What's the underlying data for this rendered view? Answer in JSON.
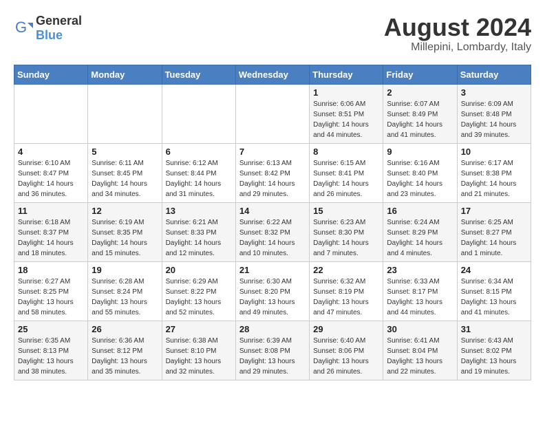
{
  "header": {
    "logo_general": "General",
    "logo_blue": "Blue",
    "title": "August 2024",
    "location": "Millepini, Lombardy, Italy"
  },
  "weekdays": [
    "Sunday",
    "Monday",
    "Tuesday",
    "Wednesday",
    "Thursday",
    "Friday",
    "Saturday"
  ],
  "weeks": [
    [
      {
        "day": "",
        "info": ""
      },
      {
        "day": "",
        "info": ""
      },
      {
        "day": "",
        "info": ""
      },
      {
        "day": "",
        "info": ""
      },
      {
        "day": "1",
        "info": "Sunrise: 6:06 AM\nSunset: 8:51 PM\nDaylight: 14 hours\nand 44 minutes."
      },
      {
        "day": "2",
        "info": "Sunrise: 6:07 AM\nSunset: 8:49 PM\nDaylight: 14 hours\nand 41 minutes."
      },
      {
        "day": "3",
        "info": "Sunrise: 6:09 AM\nSunset: 8:48 PM\nDaylight: 14 hours\nand 39 minutes."
      }
    ],
    [
      {
        "day": "4",
        "info": "Sunrise: 6:10 AM\nSunset: 8:47 PM\nDaylight: 14 hours\nand 36 minutes."
      },
      {
        "day": "5",
        "info": "Sunrise: 6:11 AM\nSunset: 8:45 PM\nDaylight: 14 hours\nand 34 minutes."
      },
      {
        "day": "6",
        "info": "Sunrise: 6:12 AM\nSunset: 8:44 PM\nDaylight: 14 hours\nand 31 minutes."
      },
      {
        "day": "7",
        "info": "Sunrise: 6:13 AM\nSunset: 8:42 PM\nDaylight: 14 hours\nand 29 minutes."
      },
      {
        "day": "8",
        "info": "Sunrise: 6:15 AM\nSunset: 8:41 PM\nDaylight: 14 hours\nand 26 minutes."
      },
      {
        "day": "9",
        "info": "Sunrise: 6:16 AM\nSunset: 8:40 PM\nDaylight: 14 hours\nand 23 minutes."
      },
      {
        "day": "10",
        "info": "Sunrise: 6:17 AM\nSunset: 8:38 PM\nDaylight: 14 hours\nand 21 minutes."
      }
    ],
    [
      {
        "day": "11",
        "info": "Sunrise: 6:18 AM\nSunset: 8:37 PM\nDaylight: 14 hours\nand 18 minutes."
      },
      {
        "day": "12",
        "info": "Sunrise: 6:19 AM\nSunset: 8:35 PM\nDaylight: 14 hours\nand 15 minutes."
      },
      {
        "day": "13",
        "info": "Sunrise: 6:21 AM\nSunset: 8:33 PM\nDaylight: 14 hours\nand 12 minutes."
      },
      {
        "day": "14",
        "info": "Sunrise: 6:22 AM\nSunset: 8:32 PM\nDaylight: 14 hours\nand 10 minutes."
      },
      {
        "day": "15",
        "info": "Sunrise: 6:23 AM\nSunset: 8:30 PM\nDaylight: 14 hours\nand 7 minutes."
      },
      {
        "day": "16",
        "info": "Sunrise: 6:24 AM\nSunset: 8:29 PM\nDaylight: 14 hours\nand 4 minutes."
      },
      {
        "day": "17",
        "info": "Sunrise: 6:25 AM\nSunset: 8:27 PM\nDaylight: 14 hours\nand 1 minute."
      }
    ],
    [
      {
        "day": "18",
        "info": "Sunrise: 6:27 AM\nSunset: 8:25 PM\nDaylight: 13 hours\nand 58 minutes."
      },
      {
        "day": "19",
        "info": "Sunrise: 6:28 AM\nSunset: 8:24 PM\nDaylight: 13 hours\nand 55 minutes."
      },
      {
        "day": "20",
        "info": "Sunrise: 6:29 AM\nSunset: 8:22 PM\nDaylight: 13 hours\nand 52 minutes."
      },
      {
        "day": "21",
        "info": "Sunrise: 6:30 AM\nSunset: 8:20 PM\nDaylight: 13 hours\nand 49 minutes."
      },
      {
        "day": "22",
        "info": "Sunrise: 6:32 AM\nSunset: 8:19 PM\nDaylight: 13 hours\nand 47 minutes."
      },
      {
        "day": "23",
        "info": "Sunrise: 6:33 AM\nSunset: 8:17 PM\nDaylight: 13 hours\nand 44 minutes."
      },
      {
        "day": "24",
        "info": "Sunrise: 6:34 AM\nSunset: 8:15 PM\nDaylight: 13 hours\nand 41 minutes."
      }
    ],
    [
      {
        "day": "25",
        "info": "Sunrise: 6:35 AM\nSunset: 8:13 PM\nDaylight: 13 hours\nand 38 minutes."
      },
      {
        "day": "26",
        "info": "Sunrise: 6:36 AM\nSunset: 8:12 PM\nDaylight: 13 hours\nand 35 minutes."
      },
      {
        "day": "27",
        "info": "Sunrise: 6:38 AM\nSunset: 8:10 PM\nDaylight: 13 hours\nand 32 minutes."
      },
      {
        "day": "28",
        "info": "Sunrise: 6:39 AM\nSunset: 8:08 PM\nDaylight: 13 hours\nand 29 minutes."
      },
      {
        "day": "29",
        "info": "Sunrise: 6:40 AM\nSunset: 8:06 PM\nDaylight: 13 hours\nand 26 minutes."
      },
      {
        "day": "30",
        "info": "Sunrise: 6:41 AM\nSunset: 8:04 PM\nDaylight: 13 hours\nand 22 minutes."
      },
      {
        "day": "31",
        "info": "Sunrise: 6:43 AM\nSunset: 8:02 PM\nDaylight: 13 hours\nand 19 minutes."
      }
    ]
  ]
}
